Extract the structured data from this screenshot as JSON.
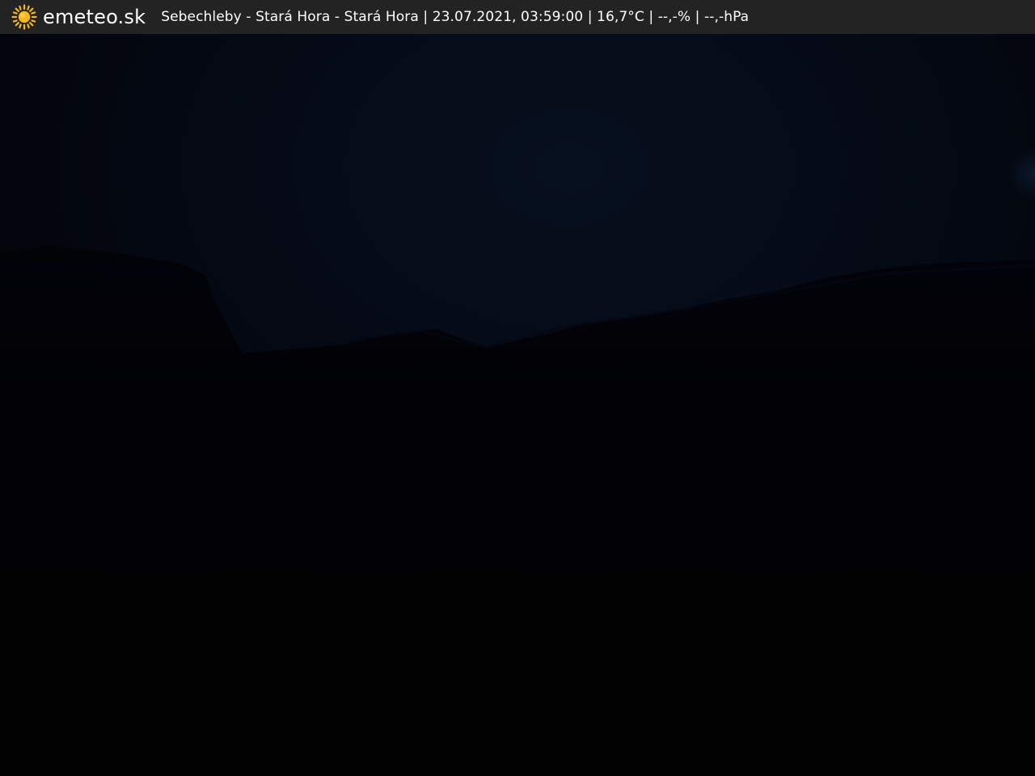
{
  "header": {
    "logo_icon": "sun-icon",
    "logo_text": "emeteo.sk",
    "caption": "Sebechleby - Stará Hora - Stará Hora | 23.07.2021, 03:59:00 | 16,7°C | --,-% | --,-hPa"
  },
  "colors": {
    "topbar_background": "#232323",
    "sun_yellow": "#f5b81c",
    "night_sky": "#050a16",
    "dark_ground": "#010102"
  },
  "scene": {
    "description_icon": "night-webcam-landscape"
  }
}
